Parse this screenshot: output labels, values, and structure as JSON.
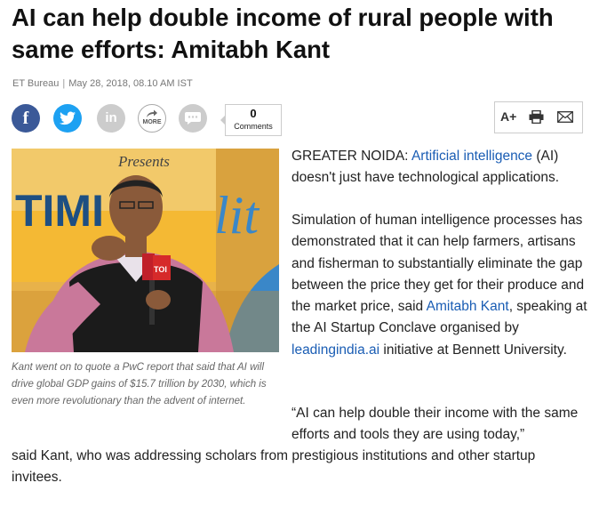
{
  "article": {
    "headline": "AI can help double income of rural people with same efforts: Amitabh Kant",
    "source": "ET Bureau",
    "date": "May 28, 2018, 08.10 AM IST"
  },
  "share": {
    "facebook": "f",
    "linkedin": "in",
    "more_label": "MORE",
    "comment_count": "0",
    "comments_label": "Comments"
  },
  "tools": {
    "font_size_label": "A+"
  },
  "image": {
    "presents_text": "Presents",
    "banner_text": "TIMI",
    "script_text": "lit",
    "mic_text": "TOI"
  },
  "caption": "Kant went on to quote a PwC report that said that AI will drive global GDP gains of $15.7 trillion by 2030, which is even more revolutionary than the advent of internet.",
  "body": {
    "p1_lead": "GREATER NOIDA: ",
    "p1_link": "Artificial intelligence",
    "p1_rest": " (AI) doesn't just have technological applications.",
    "p2_a": "Simulation of human intelligence processes has demonstrated that it can help farmers, artisans and fisherman to substantially eliminate the gap between the price they get for their produce and the market price, said ",
    "p2_link1": "Amitabh Kant",
    "p2_b": ", speaking at the AI Startup Conclave organised by ",
    "p2_link2": "leadingindia.ai",
    "p2_c": " initiative at Bennett University.",
    "p3": "“AI can help double their income with the same efforts and tools they are using today,”",
    "p4": "said Kant, who was addressing scholars from prestigious institutions and other startup invitees."
  },
  "colors": {
    "facebook": "#3b5998",
    "twitter": "#1da1f2",
    "link": "#1a5db4"
  }
}
